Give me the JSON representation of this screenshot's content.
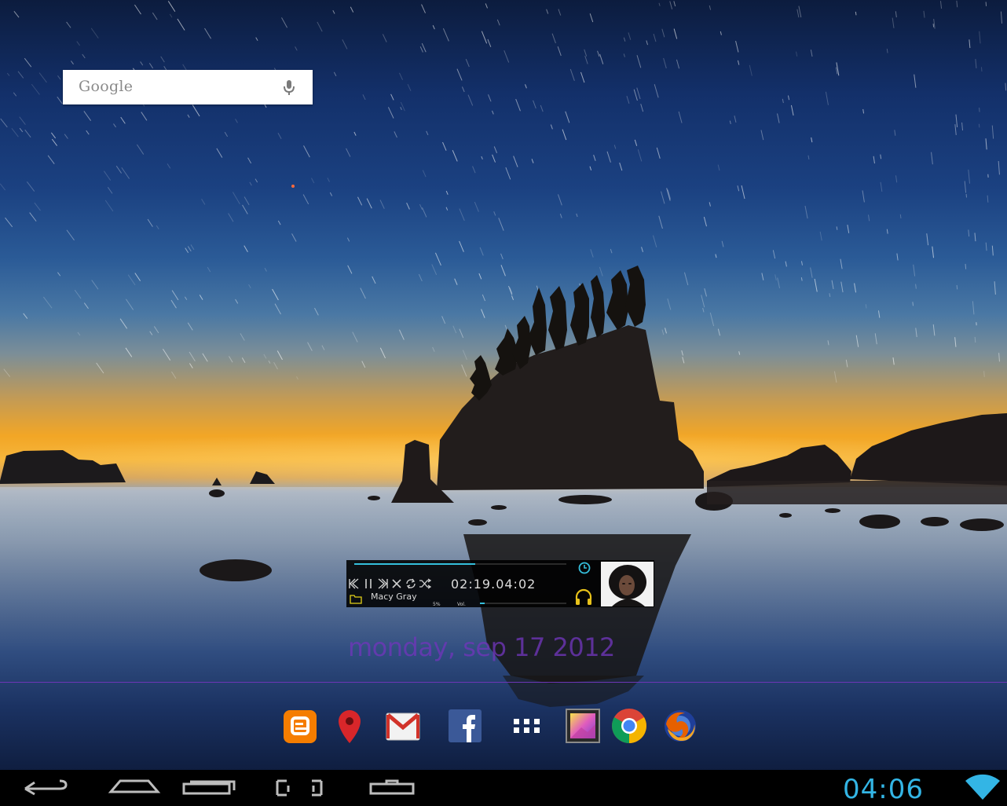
{
  "search": {
    "logo": "Google",
    "icons": [
      "mic-icon"
    ]
  },
  "player": {
    "time": "02:19.04:02",
    "artist": "Macy Gray",
    "volume_percent": "5%",
    "volume_label": "Vol.",
    "progress_fraction": 0.57,
    "volume_fraction": 0.05,
    "accent": "#35bfdc",
    "icons": [
      "previous-icon",
      "pause-icon",
      "next-icon",
      "stop-icon",
      "repeat-icon",
      "shuffle-icon",
      "folder-icon",
      "sleep-timer-icon",
      "headphones-icon",
      "album-art"
    ]
  },
  "date_widget": {
    "text": "monday, sep 17 2012",
    "color": "#7036ba"
  },
  "dock": {
    "apps": [
      "Blogger",
      "Maps",
      "Gmail",
      "Facebook",
      "Apps",
      "Gallery",
      "Chrome",
      "Firefox"
    ]
  },
  "navbar": {
    "buttons": [
      "back-icon",
      "home-icon",
      "recent-apps-icon",
      "screenshot-icon",
      "menu-icon"
    ]
  },
  "status": {
    "clock": "04:06",
    "clock_color": "#33b5e5",
    "icons": [
      "wifi-icon"
    ]
  }
}
